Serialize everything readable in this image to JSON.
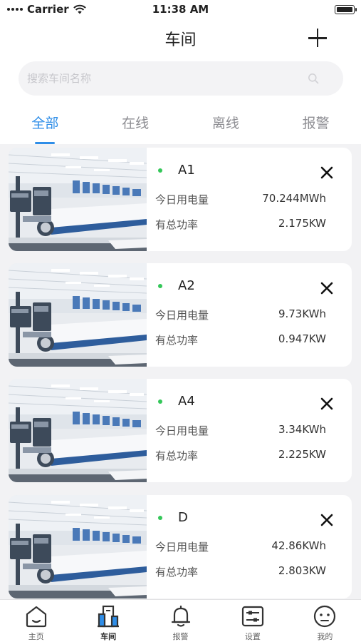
{
  "status_bar": {
    "carrier": "Carrier",
    "time": "11:38 AM"
  },
  "nav": {
    "title": "车间"
  },
  "search": {
    "placeholder": "搜索车间名称"
  },
  "tabs": [
    {
      "label": "全部",
      "active": true
    },
    {
      "label": "在线",
      "active": false
    },
    {
      "label": "离线",
      "active": false
    },
    {
      "label": "报警",
      "active": false
    }
  ],
  "workshops": [
    {
      "name": "A1",
      "online": true,
      "energy_label": "今日用电量",
      "energy_value": "70.244MWh",
      "power_label": "有总功率",
      "power_value": "2.175KW"
    },
    {
      "name": "A2",
      "online": true,
      "energy_label": "今日用电量",
      "energy_value": "9.73KWh",
      "power_label": "有总功率",
      "power_value": "0.947KW"
    },
    {
      "name": "A4",
      "online": true,
      "energy_label": "今日用电量",
      "energy_value": "3.34KWh",
      "power_label": "有总功率",
      "power_value": "2.225KW"
    },
    {
      "name": "D",
      "online": true,
      "energy_label": "今日用电量",
      "energy_value": "42.86KWh",
      "power_label": "有总功率",
      "power_value": "2.803KW"
    }
  ],
  "tab_bar": [
    {
      "label": "主页",
      "icon": "home-icon",
      "active": false
    },
    {
      "label": "车间",
      "icon": "building-icon",
      "active": true
    },
    {
      "label": "报警",
      "icon": "bell-icon",
      "active": false
    },
    {
      "label": "设置",
      "icon": "sliders-icon",
      "active": false
    },
    {
      "label": "我的",
      "icon": "face-icon",
      "active": false
    }
  ],
  "colors": {
    "accent": "#2f8ee8",
    "online": "#34c759",
    "background": "#f2f2f4"
  }
}
